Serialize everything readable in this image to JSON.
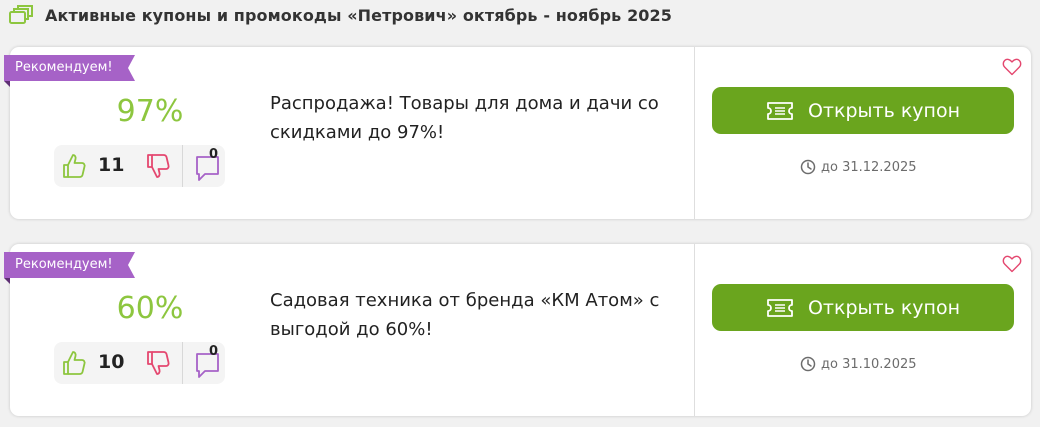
{
  "page": {
    "title": "Активные купоны и промокоды «Петрович» октябрь - ноябрь 2025"
  },
  "coupons": [
    {
      "badge": "Рекомендуем!",
      "percent": "97%",
      "likes": "11",
      "comments": "0",
      "description": "Распродажа! Товары для дома и дачи со скидками до 97%!",
      "button_label": "Открыть купон",
      "expiry": "до 31.12.2025"
    },
    {
      "badge": "Рекомендуем!",
      "percent": "60%",
      "likes": "10",
      "comments": "0",
      "description": "Садовая техника от бренда «КМ Атом» с выгодой до 60%!",
      "button_label": "Открыть купон",
      "expiry": "до 31.10.2025"
    }
  ],
  "colors": {
    "accent_green": "#6aa51e",
    "percent_green": "#8dc63f",
    "badge_purple": "#a662c7",
    "dislike_pink": "#e4476f",
    "like_green": "#8dc63f"
  },
  "icons": {
    "header": "coupons-stack-icon",
    "like": "thumbs-up-icon",
    "dislike": "thumbs-down-icon",
    "comments": "comment-bubble-icon",
    "favorite": "heart-icon",
    "ticket": "ticket-icon",
    "expiry": "clock-icon"
  }
}
